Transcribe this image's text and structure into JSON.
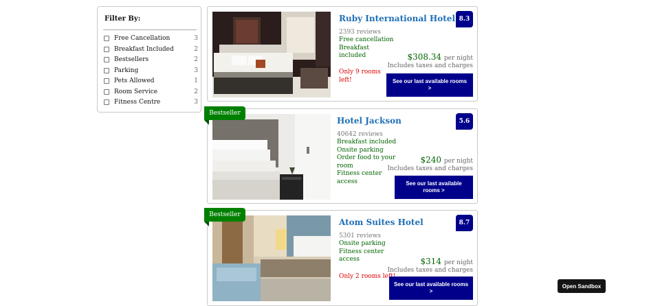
{
  "filter": {
    "title": "Filter By:",
    "items": [
      {
        "label": "Free Cancellation",
        "count": "3"
      },
      {
        "label": "Breakfast Included",
        "count": "2"
      },
      {
        "label": "Bestsellers",
        "count": "2"
      },
      {
        "label": "Parking",
        "count": "3"
      },
      {
        "label": "Pets Allowed",
        "count": "1"
      },
      {
        "label": "Room Service",
        "count": "2"
      },
      {
        "label": "Fitness Centre",
        "count": "3"
      }
    ]
  },
  "hotels": [
    {
      "name": "Ruby International Hotel",
      "score": "8.3",
      "reviews": "2393 reviews",
      "perks": [
        "Free cancellation",
        "Breakfast",
        "included"
      ],
      "warning": "Only 9 rooms left!",
      "price": "$308.34",
      "price_unit": "per night",
      "taxes": "Includes taxes and charges",
      "cta": "See our last available rooms >"
    },
    {
      "badge": "Bestseller",
      "name": "Hotel Jackson",
      "score": "5.6",
      "reviews": "40642 reviews",
      "perks": [
        "Breakfast included",
        "Onsite parking",
        "Order food to your",
        "room",
        "Fitness center access"
      ],
      "price": "$240",
      "price_unit": "per night",
      "taxes": "Includes taxes and charges",
      "cta": "See our last available rooms >"
    },
    {
      "badge": "Bestseller",
      "name": "Atom Suites Hotel",
      "score": "8.7",
      "reviews": "5301 reviews",
      "perks": [
        "Onsite parking",
        "Fitness center",
        "access"
      ],
      "warning": "Only 2 rooms left!",
      "price": "$314",
      "price_unit": "per night",
      "taxes": "Includes taxes and charges",
      "cta": "See our last available rooms >"
    }
  ],
  "sandbox_button": "Open Sandbox",
  "colors": {
    "accent": "#00008b",
    "link": "#1f6fb6",
    "perk": "#006400",
    "warning": "#e00000",
    "badge": "#008000"
  }
}
